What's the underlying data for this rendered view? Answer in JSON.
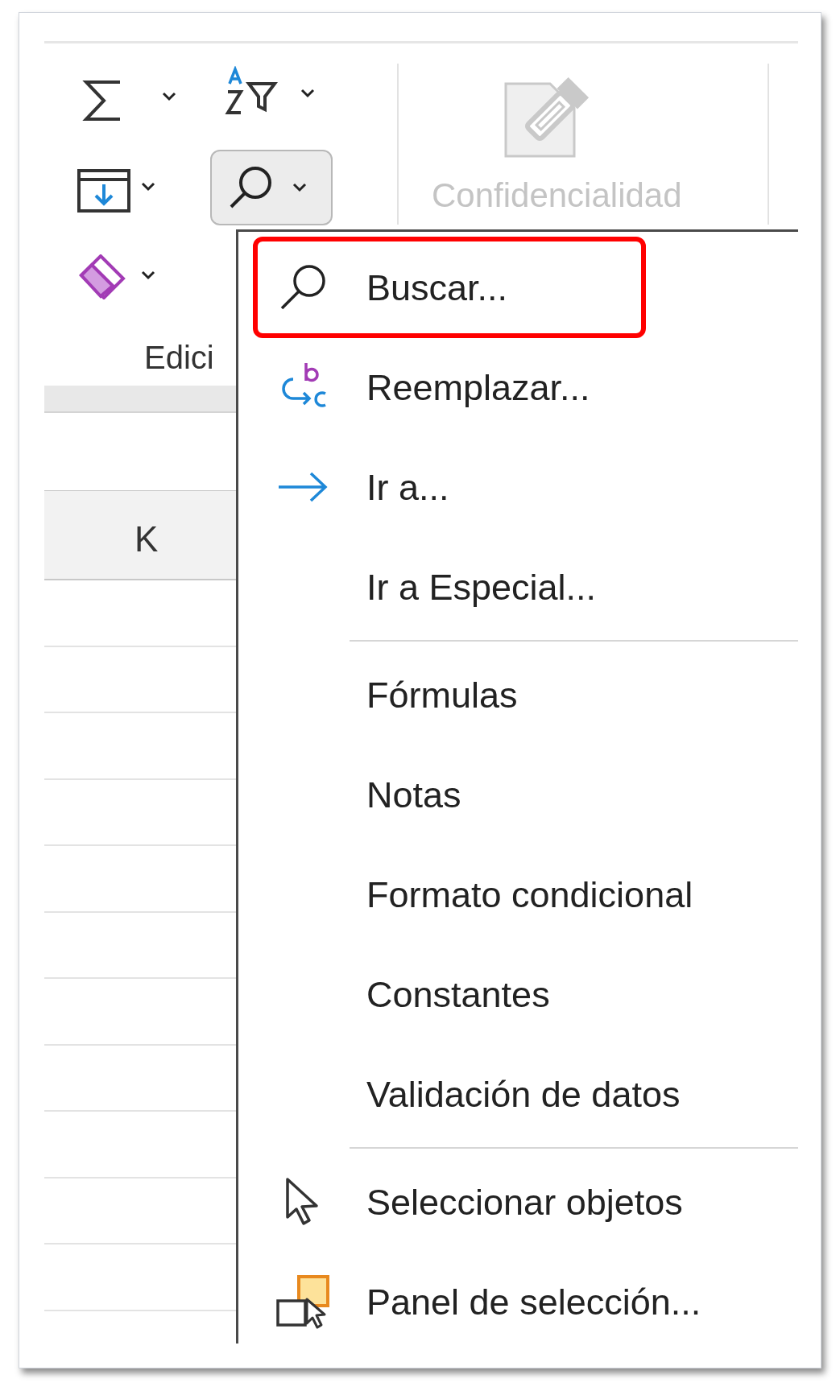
{
  "ribbon": {
    "editing_group": {
      "label": "Edici",
      "find_button": {
        "pressed": true
      }
    },
    "sensitivity_group": {
      "label": "Confidencialidad",
      "disabled": true
    }
  },
  "sheet": {
    "column_header": "K"
  },
  "menu": {
    "items": [
      {
        "kind": "search",
        "label": "Buscar...",
        "selected": true
      },
      {
        "kind": "replace",
        "label": "Reemplazar...",
        "selected": false
      },
      {
        "kind": "goto",
        "label": "Ir a...",
        "selected": false
      },
      {
        "kind": "plain",
        "label": "Ir a Especial...",
        "selected": false
      },
      {
        "kind": "separator"
      },
      {
        "kind": "plain",
        "label": "Fórmulas",
        "selected": false
      },
      {
        "kind": "plain",
        "label": "Notas",
        "selected": false
      },
      {
        "kind": "plain",
        "label": "Formato condicional",
        "selected": false
      },
      {
        "kind": "plain",
        "label": "Constantes",
        "selected": false
      },
      {
        "kind": "plain",
        "label": "Validación de datos",
        "selected": false
      },
      {
        "kind": "separator"
      },
      {
        "kind": "select",
        "label": "Seleccionar objetos",
        "selected": false
      },
      {
        "kind": "panel",
        "label": "Panel de selección...",
        "selected": false
      }
    ]
  }
}
